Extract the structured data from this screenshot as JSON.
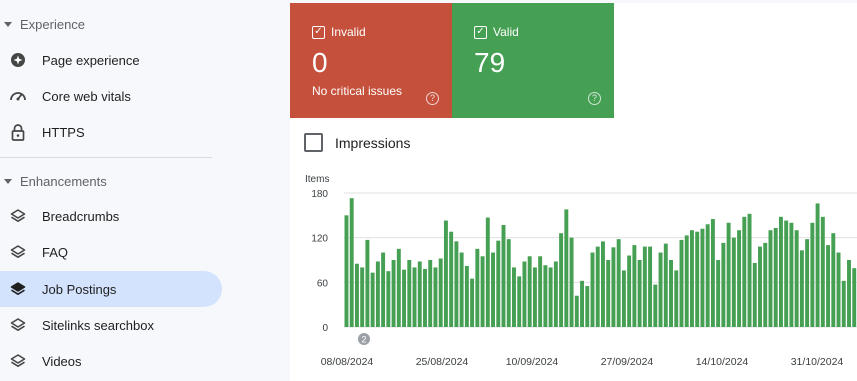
{
  "sidebar": {
    "experience_header": "Experience",
    "enhancements_header": "Enhancements",
    "experience_items": [
      {
        "label": "Page experience",
        "icon": "page-experience-icon"
      },
      {
        "label": "Core web vitals",
        "icon": "gauge-icon"
      },
      {
        "label": "HTTPS",
        "icon": "lock-icon"
      }
    ],
    "enhancement_items": [
      {
        "label": "Breadcrumbs",
        "icon": "layers-icon"
      },
      {
        "label": "FAQ",
        "icon": "layers-icon"
      },
      {
        "label": "Job Postings",
        "icon": "layers-icon",
        "active": true
      },
      {
        "label": "Sitelinks searchbox",
        "icon": "layers-icon"
      },
      {
        "label": "Videos",
        "icon": "layers-icon"
      }
    ]
  },
  "cards": {
    "invalid": {
      "label": "Invalid",
      "count": "0",
      "sub": "No critical issues",
      "color": "#c5513c"
    },
    "valid": {
      "label": "Valid",
      "count": "79",
      "color": "#46a053"
    }
  },
  "impressions_label": "Impressions",
  "chart_data": {
    "type": "bar",
    "ylabel": "Items",
    "ylim": [
      0,
      180
    ],
    "yticks": [
      "180",
      "120",
      "60",
      "0"
    ],
    "xticks": [
      "08/08/2024",
      "25/08/2024",
      "10/09/2024",
      "27/09/2024",
      "14/10/2024",
      "31/10/2024"
    ],
    "annotation": "2",
    "color": "#46a053",
    "values": [
      150,
      173,
      85,
      80,
      117,
      73,
      88,
      100,
      75,
      90,
      105,
      77,
      90,
      80,
      88,
      78,
      90,
      80,
      92,
      143,
      128,
      115,
      100,
      82,
      65,
      105,
      95,
      147,
      100,
      116,
      137,
      118,
      80,
      68,
      88,
      95,
      80,
      95,
      83,
      80,
      88,
      126,
      158,
      120,
      42,
      62,
      55,
      100,
      108,
      115,
      90,
      107,
      118,
      76,
      96,
      110,
      90,
      108,
      108,
      57,
      100,
      112,
      90,
      76,
      117,
      123,
      130,
      128,
      132,
      138,
      145,
      90,
      113,
      140,
      120,
      130,
      148,
      152,
      86,
      108,
      113,
      130,
      133,
      148,
      143,
      140,
      130,
      103,
      118,
      140,
      166,
      148,
      110,
      126,
      100,
      62,
      90,
      79
    ]
  }
}
